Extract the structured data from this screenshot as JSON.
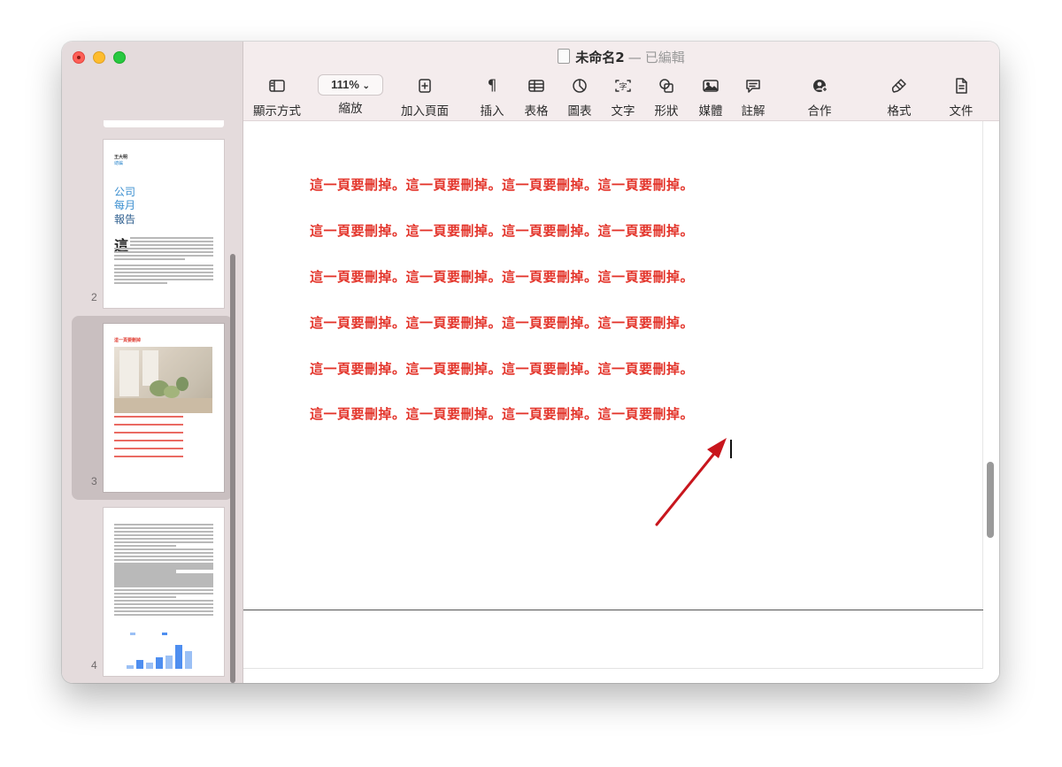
{
  "window": {
    "title_name": "未命名2",
    "title_separator": "—",
    "title_status": "已編輯"
  },
  "toolbar": {
    "view_label": "顯示方式",
    "zoom_value": "111%",
    "zoom_label": "縮放",
    "add_page_label": "加入頁面",
    "insert_label": "插入",
    "table_label": "表格",
    "chart_label": "圖表",
    "text_label": "文字",
    "shape_label": "形狀",
    "media_label": "媒體",
    "comment_label": "註解",
    "collaborate_label": "合作",
    "format_label": "格式",
    "document_label": "文件"
  },
  "sidebar": {
    "pages": [
      {
        "number": "2",
        "author": "王大明",
        "subtitle": "總編",
        "title_lines": [
          "公司",
          "每月",
          "報告"
        ],
        "dropcap": "這"
      },
      {
        "number": "3",
        "heading": "這一頁要刪掉",
        "selected": true
      },
      {
        "number": "4",
        "chart_bars": [
          0.15,
          0.35,
          0.25,
          0.45,
          0.55,
          0.95,
          0.7
        ]
      }
    ]
  },
  "document": {
    "lines": [
      "這一頁要刪掉。這一頁要刪掉。這一頁要刪掉。這一頁要刪掉。",
      "這一頁要刪掉。這一頁要刪掉。這一頁要刪掉。這一頁要刪掉。",
      "這一頁要刪掉。這一頁要刪掉。這一頁要刪掉。這一頁要刪掉。",
      "這一頁要刪掉。這一頁要刪掉。這一頁要刪掉。這一頁要刪掉。",
      "這一頁要刪掉。這一頁要刪掉。這一頁要刪掉。這一頁要刪掉。",
      "這一頁要刪掉。這一頁要刪掉。這一頁要刪掉。這一頁要刪掉。"
    ],
    "text_color": "#e3342a",
    "annotation_arrow_color": "#c8161d"
  }
}
